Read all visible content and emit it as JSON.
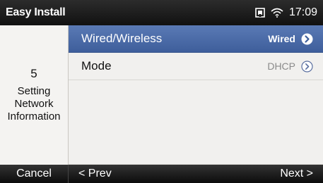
{
  "statusbar": {
    "title": "Easy Install",
    "time": "17:09",
    "icons": [
      "network-port-icon",
      "wifi-icon"
    ]
  },
  "left_panel": {
    "step_number": "5",
    "step_title": "Setting\nNetwork\nInformation"
  },
  "list": {
    "items": [
      {
        "label": "Wired/Wireless",
        "value": "Wired",
        "selected": true
      },
      {
        "label": "Mode",
        "value": "DHCP",
        "selected": false
      }
    ]
  },
  "softkeys": {
    "cancel": "Cancel",
    "prev": "< Prev",
    "next": "Next >"
  },
  "colors": {
    "selected_row": "#4a6aa8",
    "bar_bg": "#111111",
    "panel_bg": "#f1f0ee"
  }
}
